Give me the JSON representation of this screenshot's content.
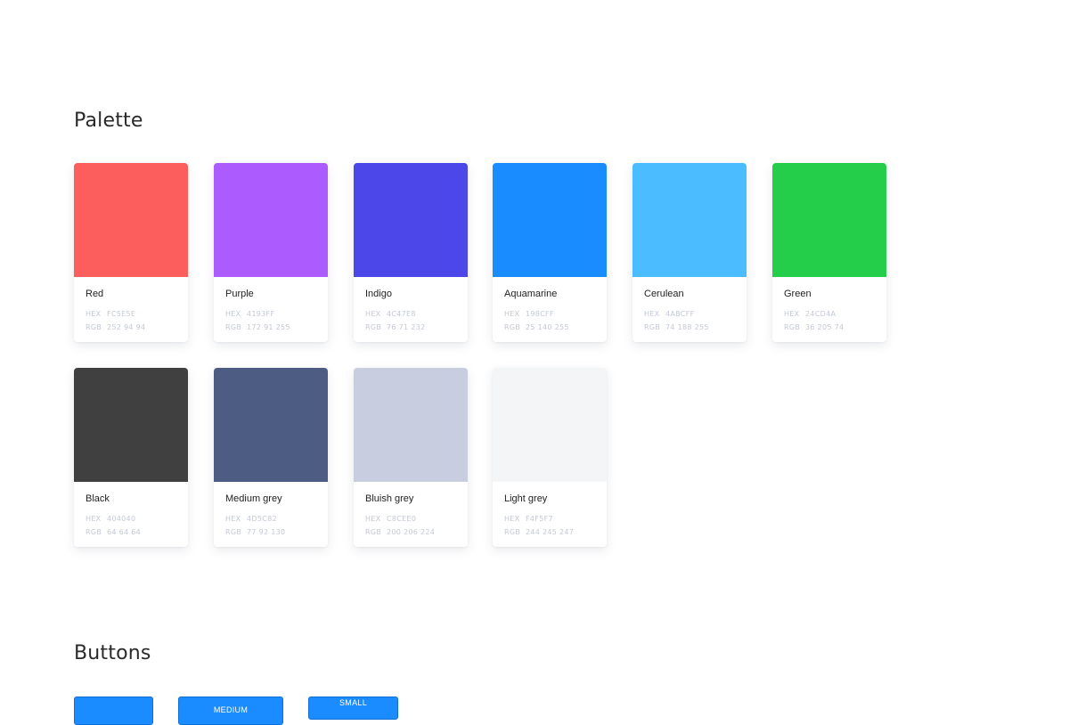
{
  "palette": {
    "title": "Palette",
    "swatches": [
      {
        "name": "Red",
        "hex_label": "HEX",
        "hex": "FC5E5E",
        "rgb_label": "RGB",
        "rgb": "252 94 94",
        "color": "#FC5E5E"
      },
      {
        "name": "Purple",
        "hex_label": "HEX",
        "hex": "4193FF",
        "rgb_label": "RGB",
        "rgb": "172 91 255",
        "color": "#AC5BFF"
      },
      {
        "name": "Indigo",
        "hex_label": "HEX",
        "hex": "4C47E8",
        "rgb_label": "RGB",
        "rgb": "76 71 232",
        "color": "#4C47E8"
      },
      {
        "name": "Aquamarine",
        "hex_label": "HEX",
        "hex": "198CFF",
        "rgb_label": "RGB",
        "rgb": "25 140 255",
        "color": "#198CFF"
      },
      {
        "name": "Cerulean",
        "hex_label": "HEX",
        "hex": "4ABCFF",
        "rgb_label": "RGB",
        "rgb": "74 188 255",
        "color": "#4ABCFF"
      },
      {
        "name": "Green",
        "hex_label": "HEX",
        "hex": "24CD4A",
        "rgb_label": "RGB",
        "rgb": "36 205 74",
        "color": "#24CD4A"
      },
      {
        "name": "Black",
        "hex_label": "HEX",
        "hex": "404040",
        "rgb_label": "RGB",
        "rgb": "64 64 64",
        "color": "#404040"
      },
      {
        "name": "Medium grey",
        "hex_label": "HEX",
        "hex": "4D5C82",
        "rgb_label": "RGB",
        "rgb": "77 92 130",
        "color": "#4D5C82"
      },
      {
        "name": "Bluish grey",
        "hex_label": "HEX",
        "hex": "C8CEE0",
        "rgb_label": "RGB",
        "rgb": "200 206 224",
        "color": "#C8CEE0"
      },
      {
        "name": "Light grey",
        "hex_label": "HEX",
        "hex": "F4F5F7",
        "rgb_label": "RGB",
        "rgb": "244 245 247",
        "color": "#F4F5F7"
      }
    ]
  },
  "buttons": {
    "title": "Buttons",
    "large_label": "",
    "medium_label": "MEDIUM",
    "small_label": "SMALL",
    "accent": "#1B8CFF"
  }
}
